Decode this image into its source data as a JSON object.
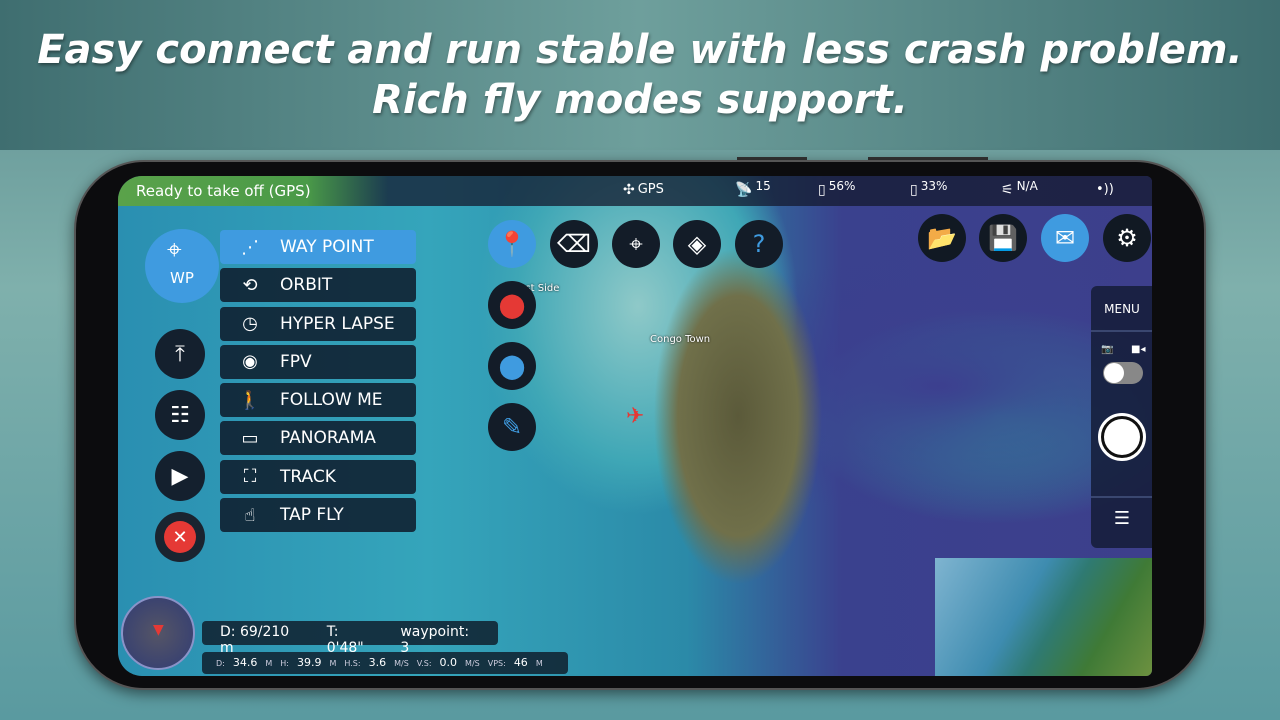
{
  "banner": {
    "line1": "Easy connect and run stable with less crash problem.",
    "line2": "Rich fly modes support."
  },
  "status": {
    "ready": "Ready to take off  (GPS)",
    "gps": "GPS",
    "satellites": "15",
    "drone_battery": "56%",
    "remote_battery": "33%",
    "signal": "N/A"
  },
  "left": {
    "wp_label": "WP"
  },
  "modes": [
    {
      "label": "WAY POINT",
      "icon": "waypoint-icon",
      "active": true
    },
    {
      "label": "ORBIT",
      "icon": "orbit-icon"
    },
    {
      "label": "HYPER LAPSE",
      "icon": "hyperlapse-icon"
    },
    {
      "label": "FPV",
      "icon": "eye-icon"
    },
    {
      "label": "FOLLOW ME",
      "icon": "follow-icon"
    },
    {
      "label": "PANORAMA",
      "icon": "panorama-icon"
    },
    {
      "label": "TRACK",
      "icon": "track-icon"
    },
    {
      "label": "TAP FLY",
      "icon": "tap-icon"
    }
  ],
  "map": {
    "labels": [
      "West Side",
      "Congo Town"
    ]
  },
  "right": {
    "menu": "MENU"
  },
  "info": {
    "distance_label": "D:",
    "distance": "69/210 m",
    "time_label": "T:",
    "time": "0'48\"",
    "waypoint_label": "waypoint:",
    "waypoint": "3"
  },
  "telemetry": {
    "d_label": "D:",
    "d": "34.6",
    "d_unit": "M",
    "h_label": "H:",
    "h": "39.9",
    "h_unit": "M",
    "hs_label": "H.S:",
    "hs": "3.6",
    "hs_unit": "M/S",
    "vs_label": "V.S:",
    "vs": "0.0",
    "vs_unit": "M/S",
    "vps_label": "VPS:",
    "vps": "46",
    "vps_unit": "M"
  },
  "colors": {
    "accent": "#3f9be0",
    "ready_green": "#5aa24a",
    "marker_red": "#e53935"
  }
}
